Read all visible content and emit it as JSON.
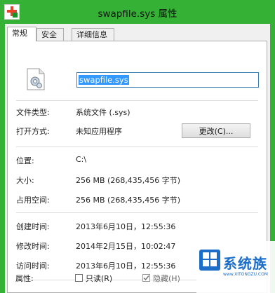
{
  "window": {
    "title": "swapfile.sys 属性"
  },
  "tabs": [
    {
      "label": "常规",
      "active": true
    },
    {
      "label": "安全",
      "active": false
    },
    {
      "label": "详细信息",
      "active": false
    }
  ],
  "general": {
    "file_name": "swapfile.sys",
    "type_label": "文件类型:",
    "type_value": "系统文件 (.sys)",
    "opens_with_label": "打开方式:",
    "opens_with_value": "未知应用程序",
    "change_button": "更改(C)...",
    "location_label": "位置:",
    "location_value": "C:\\",
    "size_label": "大小:",
    "size_value": "256 MB (268,435,456 字节)",
    "size_on_disk_label": "占用空间:",
    "size_on_disk_value": "256 MB (268,435,456 字节)",
    "created_label": "创建时间:",
    "created_value": "2013年6月10日，12:55:36",
    "modified_label": "修改时间:",
    "modified_value": "2014年2月15日，10:02:47",
    "accessed_label": "访问时间:",
    "accessed_value": "2013年6月10日，12:55:36",
    "attributes_label": "属性:",
    "readonly_label": "只读(R)",
    "readonly_checked": false,
    "hidden_label": "隐藏(H)",
    "hidden_checked": true
  },
  "watermark": {
    "text": "系统族",
    "url": "www.XITONGZU.COM"
  },
  "colors": {
    "titlebar": "#35b236",
    "selection": "#3399ff"
  }
}
